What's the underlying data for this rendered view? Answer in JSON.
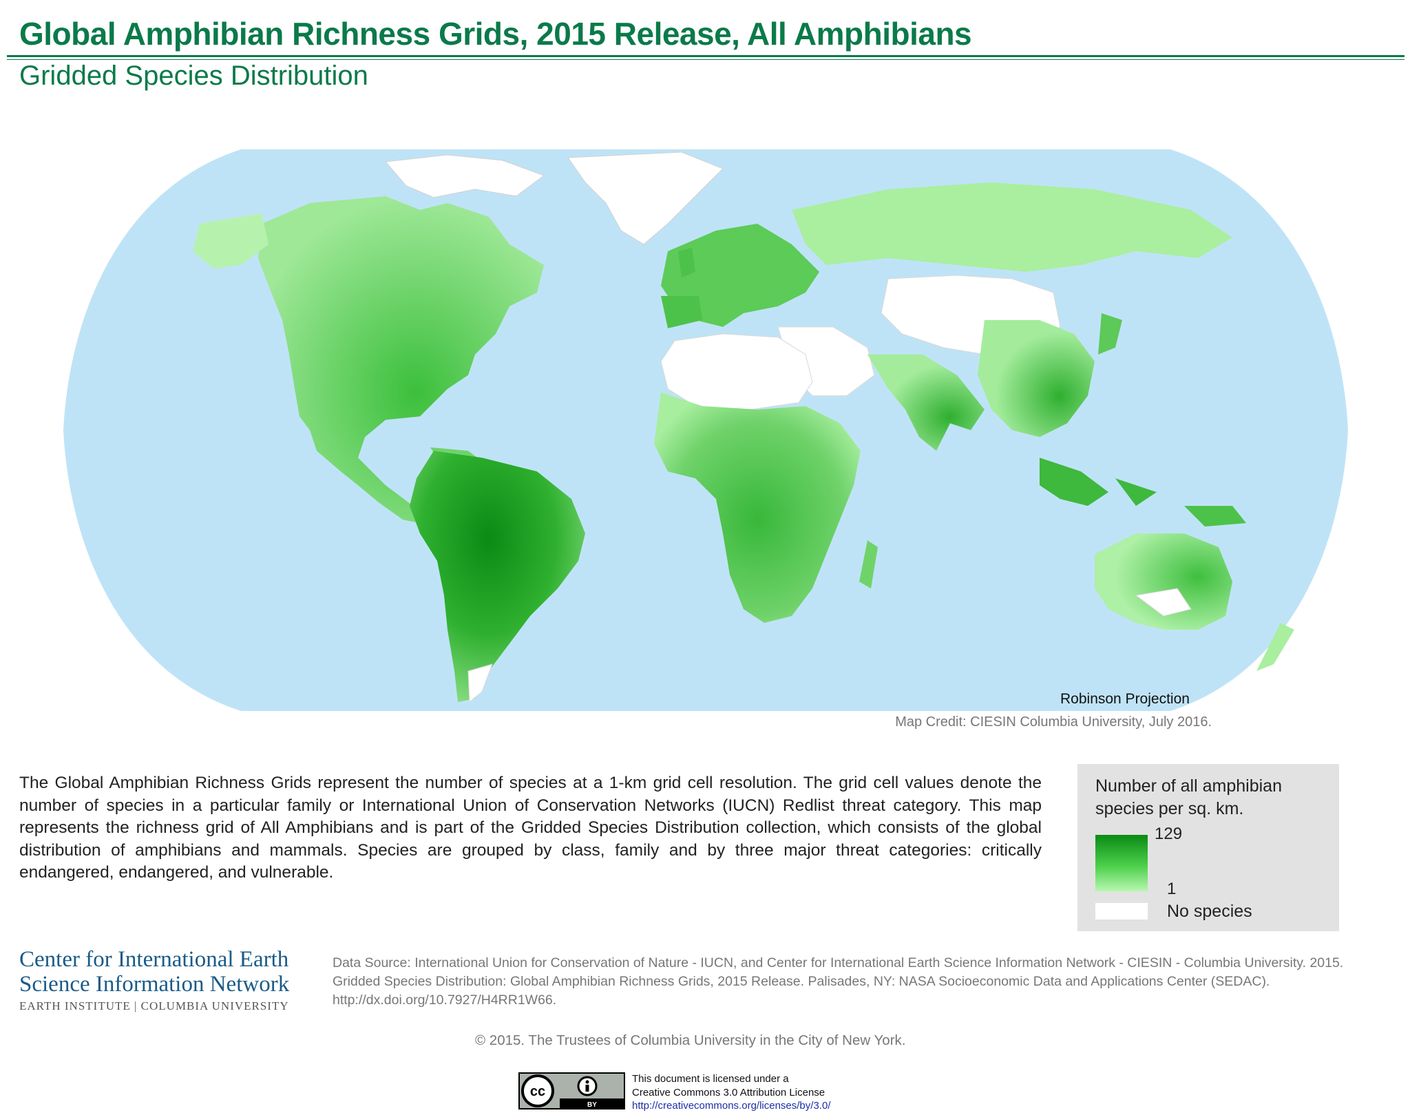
{
  "header": {
    "title": "Global Amphibian Richness Grids, 2015 Release, All Amphibians",
    "subtitle": "Gridded Species Distribution"
  },
  "map": {
    "projection_label": "Robinson Projection",
    "credit": "Map Credit: CIESIN Columbia University, July 2016.",
    "colors": {
      "ocean": "#bfe3f6",
      "no_species": "#ffffff",
      "low": "#b8f7b0",
      "high": "#0a8a14"
    }
  },
  "description": "The Global Amphibian Richness Grids represent the number of species at a 1-km grid cell resolution. The grid cell values denote the number of species in a particular family or International Union of Conservation Networks (IUCN) Redlist threat category. This map represents the richness grid of All Amphibians and is part of the Gridded Species Distribution collection, which consists of the global distribution of amphibians and mammals. Species are grouped by class, family and by three major threat categories: critically endangered, endangered, and vulnerable.",
  "legend": {
    "title": "Number of all amphibian species per sq. km.",
    "max_label": "129",
    "min_label": "1",
    "none_label": "No species"
  },
  "logo": {
    "line1": "Center for International Earth",
    "line2": "Science Information Network",
    "line3": "EARTH INSTITUTE | COLUMBIA UNIVERSITY"
  },
  "source": "Data Source: International Union for Conservation of Nature - IUCN, and Center for International Earth Science Information Network - CIESIN - Columbia University. 2015. Gridded Species Distribution: Global Amphibian Richness Grids, 2015 Release. Palisades, NY: NASA Socioeconomic Data and Applications Center (SEDAC). http://dx.doi.org/10.7927/H4RR1W66.",
  "copyright": "© 2015. The Trustees of Columbia University in the City of New York.",
  "license": {
    "line1": "This document is licensed under a",
    "line2": "Creative Commons 3.0 Attribution License",
    "link": "http://creativecommons.org/licenses/by/3.0/",
    "badge_cc": "cc",
    "badge_by": "BY"
  }
}
